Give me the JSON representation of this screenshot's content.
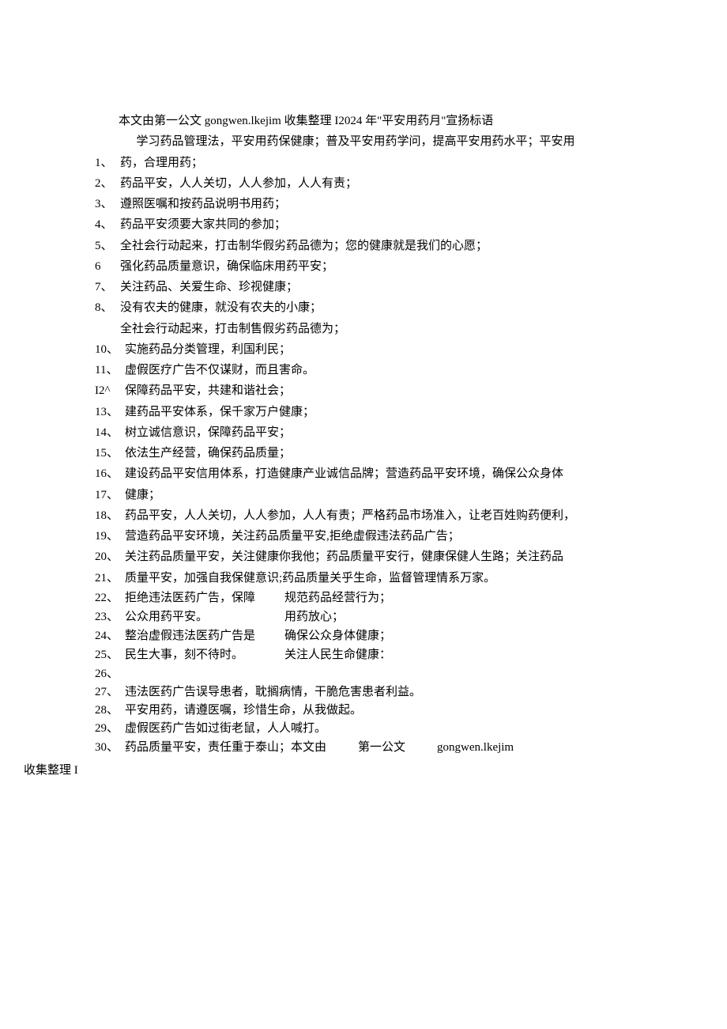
{
  "intro": {
    "line1": "本文由第一公文 gongwen.lkejim 收集整理 I2024 年\"平安用药月\"宣扬标语",
    "line2": "学习药品管理法，平安用药保健康；普及平安用药学问，提高平安用药水平；平安用"
  },
  "items": [
    {
      "n": "1、",
      "t": "药，合理用药；"
    },
    {
      "n": "2、",
      "t": "药品平安，人人关切，人人参加，人人有责；"
    },
    {
      "n": "3、",
      "t": "遵照医嘱和按药品说明书用药；"
    },
    {
      "n": "4、",
      "t": "药品平安须要大家共同的参加；"
    },
    {
      "n": "5、",
      "t": "全社会行动起来，打击制华假劣药品德为；您的健康就是我们的心愿；"
    },
    {
      "n": "6",
      "t": "强化药品质量意识，确保临床用药平安；"
    },
    {
      "n": "7、",
      "t": "关注药品、关爱生命、珍视健康；"
    },
    {
      "n": "8、",
      "t": "没有农夫的健康，就没有农夫的小康；"
    },
    {
      "n": "",
      "t": "全社会行动起来，打击制售假劣药品德为；"
    },
    {
      "n": "10、",
      "t": "实施药品分类管理，利国利民；"
    },
    {
      "n": "11、",
      "t": "虚假医疗广告不仅谋财，而且害命。"
    },
    {
      "n": "I2^",
      "t": "保障药品平安，共建和谐社会；"
    },
    {
      "n": "13、",
      "t": "建药品平安体系，保千家万户健康；"
    },
    {
      "n": "14、",
      "t": "树立诚信意识，保障药品平安；"
    },
    {
      "n": "15、",
      "t": "依法生产经营，确保药品质量；"
    },
    {
      "n": "16、",
      "t": "建设药品平安信用体系，打造健康产业诚信品牌；营造药品平安环境，确保公众身体"
    },
    {
      "n": "17、",
      "t": "健康；"
    },
    {
      "n": "18、",
      "t": "药品平安，人人关切，人人参加，人人有责；严格药品市场准入，让老百姓购药便利，"
    },
    {
      "n": "19、",
      "t": "营造药品平安环境，关注药品质量平安,拒绝虚假违法药品广告；"
    },
    {
      "n": "20、",
      "t": "关注药品质量平安，关注健康你我他；药品质量平安行，健康保健人生路；关注药品"
    },
    {
      "n": "21、",
      "t": "质量平安，加强自我保健意识;药品质量关乎生命，监督管理情系万家。"
    }
  ],
  "twocol": {
    "left": [
      {
        "n": "22、",
        "t": "拒绝违法医药广告，保障"
      },
      {
        "n": "23、",
        "t": "公众用药平安。"
      },
      {
        "n": "24、",
        "t": "整治虚假违法医药广告是"
      },
      {
        "n": "25、",
        "t": "民生大事，刻不待时。"
      },
      {
        "n": "26、",
        "t": ""
      }
    ],
    "right": [
      "规范药品经营行为；",
      "用药放心；",
      "确保公众身体健康；",
      "关注人民生命健康："
    ]
  },
  "tail": [
    {
      "n": "27、",
      "t": "违法医药广告误导患者，耽搁病情，干脆危害患者利益。"
    },
    {
      "n": "28、",
      "t": "平安用药，请遵医嘱，珍惜生命，从我做起。"
    },
    {
      "n": "29、",
      "t": "虚假医药广告如过街老鼠，人人喊打。"
    }
  ],
  "last": {
    "n": "30、",
    "t1": "药品质量平安，责任重于泰山；本文由",
    "t2": "第一公文",
    "t3": "gongwen.lkejim"
  },
  "footer": "收集整理 I"
}
